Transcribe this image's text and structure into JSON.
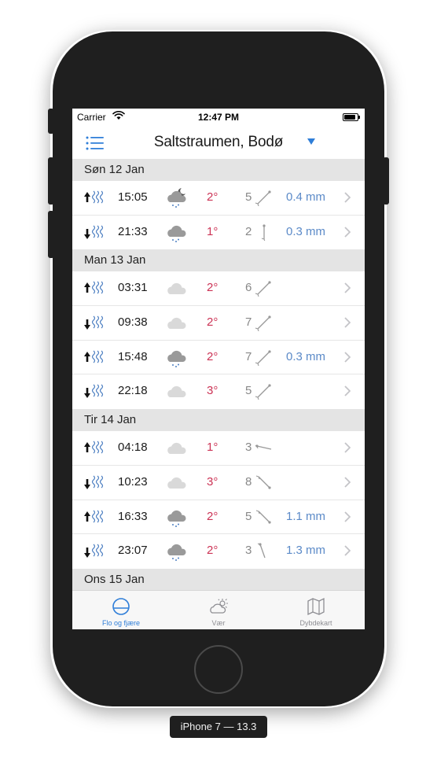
{
  "status": {
    "carrier": "Carrier",
    "time": "12:47 PM"
  },
  "nav": {
    "title": "Saltstraumen, Bodø"
  },
  "sections": [
    {
      "header": "Søn 12 Jan",
      "rows": [
        {
          "dir": "up",
          "time": "15:05",
          "weather": "cloud-night-rain",
          "temp": "2°",
          "wind": "5",
          "wind_dir": "sw",
          "precip": "0.4 mm"
        },
        {
          "dir": "down",
          "time": "21:33",
          "weather": "cloud-rain",
          "temp": "1°",
          "wind": "2",
          "wind_dir": "n",
          "precip": "0.3 mm"
        }
      ]
    },
    {
      "header": "Man 13 Jan",
      "rows": [
        {
          "dir": "up",
          "time": "03:31",
          "weather": "cloud",
          "temp": "2°",
          "wind": "6",
          "wind_dir": "sw",
          "precip": ""
        },
        {
          "dir": "down",
          "time": "09:38",
          "weather": "cloud",
          "temp": "2°",
          "wind": "7",
          "wind_dir": "sw",
          "precip": ""
        },
        {
          "dir": "up",
          "time": "15:48",
          "weather": "cloud-rain-dark",
          "temp": "2°",
          "wind": "7",
          "wind_dir": "sw",
          "precip": "0.3 mm"
        },
        {
          "dir": "down",
          "time": "22:18",
          "weather": "cloud",
          "temp": "3°",
          "wind": "5",
          "wind_dir": "sw",
          "precip": ""
        }
      ]
    },
    {
      "header": "Tir 14 Jan",
      "rows": [
        {
          "dir": "up",
          "time": "04:18",
          "weather": "cloud",
          "temp": "1°",
          "wind": "3",
          "wind_dir": "e",
          "precip": ""
        },
        {
          "dir": "down",
          "time": "10:23",
          "weather": "cloud",
          "temp": "3°",
          "wind": "8",
          "wind_dir": "se",
          "precip": ""
        },
        {
          "dir": "up",
          "time": "16:33",
          "weather": "cloud-rain-dark",
          "temp": "2°",
          "wind": "5",
          "wind_dir": "se",
          "precip": "1.1 mm"
        },
        {
          "dir": "down",
          "time": "23:07",
          "weather": "cloud-rain-dark",
          "temp": "2°",
          "wind": "3",
          "wind_dir": "s",
          "precip": "1.3 mm"
        }
      ]
    },
    {
      "header": "Ons 15 Jan",
      "rows": []
    }
  ],
  "tabs": [
    {
      "label": "Flo og fjære",
      "icon": "tide-tab-icon",
      "active": true
    },
    {
      "label": "Vær",
      "icon": "weather-tab-icon",
      "active": false
    },
    {
      "label": "Dybdekart",
      "icon": "map-tab-icon",
      "active": false
    }
  ],
  "device_label": "iPhone 7 — 13.3",
  "colors": {
    "accent": "#2f7ed8",
    "temp": "#cc3355",
    "precip": "#5b8ac8",
    "wind": "#888888"
  }
}
